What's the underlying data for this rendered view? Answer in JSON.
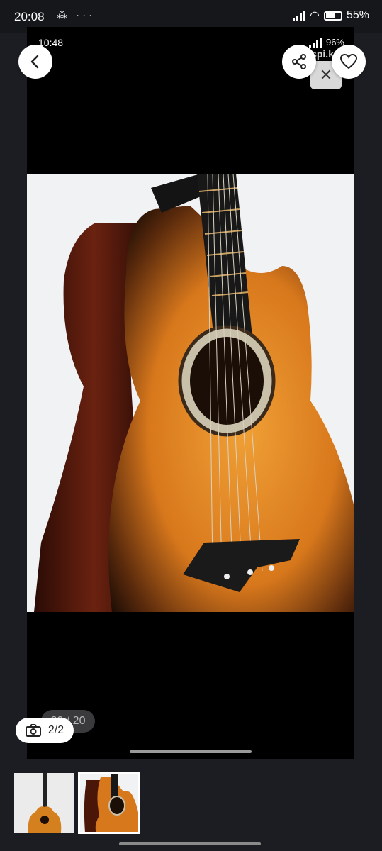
{
  "status_bar": {
    "time": "20:08",
    "battery": "55%"
  },
  "screenshot_status": {
    "time": "10:48",
    "battery": "96%",
    "watermark": "Kaspi.kz"
  },
  "inner_counter": "20 / 20",
  "photo_counter": "2/2",
  "colors": {
    "accent": "#ffffff",
    "background": "#1c1d22"
  },
  "icons": [
    "back-icon",
    "share-icon",
    "heart-icon",
    "camera-icon",
    "close-icon"
  ]
}
